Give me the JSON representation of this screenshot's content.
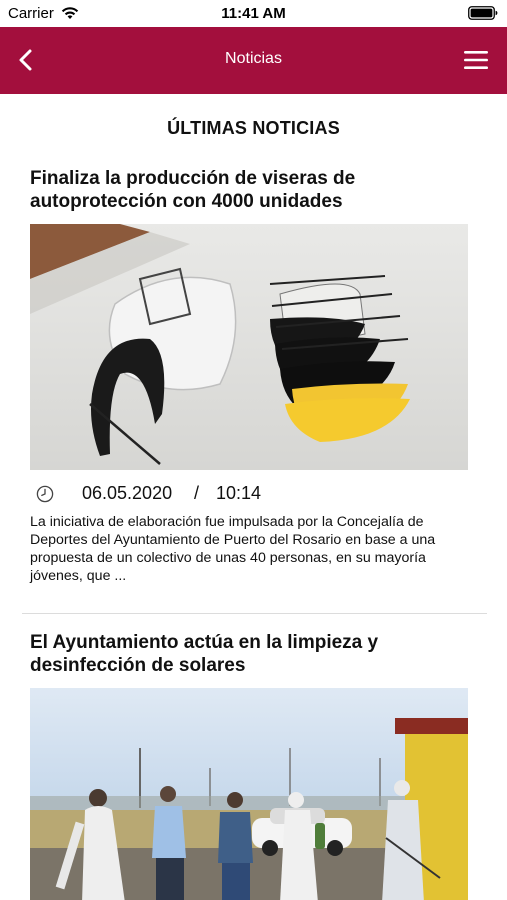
{
  "status_bar": {
    "carrier": "Carrier",
    "time": "11:41 AM"
  },
  "nav": {
    "title": "Noticias"
  },
  "section": {
    "title": "ÚLTIMAS NOTICIAS"
  },
  "articles": [
    {
      "title": "Finaliza la producción de viseras de autoprotección con 4000 unidades",
      "date": "06.05.2020",
      "separator": "/",
      "time": "10:14",
      "excerpt": "La iniciativa de elaboración fue impulsada por la Concejalía de Deportes del Ayuntamiento de Puerto del Rosario en base a una propuesta de un colectivo de unas 40 personas, en su mayoría jóvenes, que ..."
    },
    {
      "title": "El Ayuntamiento actúa en la limpieza y desinfección de solares"
    }
  ],
  "colors": {
    "nav_background": "#a30f3d",
    "nav_text": "#ffffff",
    "divider": "#dcdcdc"
  },
  "icons": [
    "wifi-icon",
    "battery-icon",
    "back-chevron-icon",
    "hamburger-menu-icon",
    "clock-icon"
  ]
}
